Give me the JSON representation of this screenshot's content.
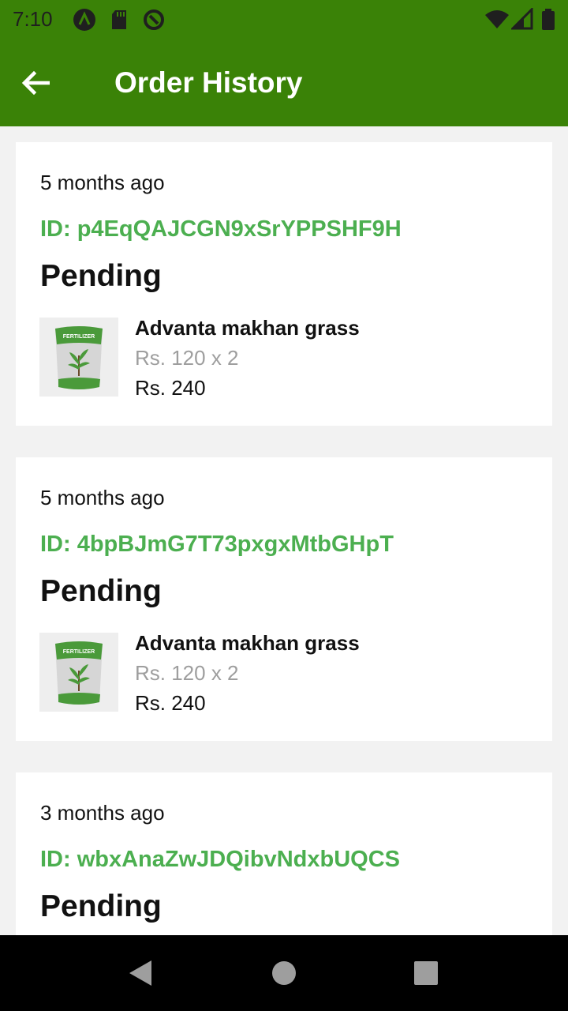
{
  "status_bar": {
    "time": "7:10",
    "icons": [
      "a-badge-icon",
      "sd-card-icon",
      "sync-icon",
      "wifi-icon",
      "signal-icon",
      "battery-icon"
    ]
  },
  "app_bar": {
    "title": "Order History",
    "back_icon": "arrow-left-icon",
    "color": "#3a8207"
  },
  "orders": [
    {
      "time": "5 months ago",
      "id": "ID: p4EqQAJCGN9xSrYPPSHF9H",
      "status": "Pending",
      "item": {
        "name": "Advanta makhan grass",
        "unit_price": "Rs. 120 x 2",
        "total": "Rs. 240",
        "image": "fertilizer-bag-icon"
      }
    },
    {
      "time": "5 months ago",
      "id": "ID: 4bpBJmG7T73pxgxMtbGHpT",
      "status": "Pending",
      "item": {
        "name": "Advanta makhan grass",
        "unit_price": "Rs. 120 x 2",
        "total": "Rs. 240",
        "image": "fertilizer-bag-icon"
      }
    },
    {
      "time": "3 months ago",
      "id": "ID: wbxAnaZwJDQibvNdxbUQCS",
      "status": "Pending"
    }
  ],
  "fertilizer_label": "FERTILIZER",
  "nav_bar": {
    "buttons": [
      "back-triangle-icon",
      "home-circle-icon",
      "recents-square-icon"
    ]
  },
  "colors": {
    "accent": "#3a8207",
    "id_green": "#4caf50",
    "muted": "#9e9e9e",
    "background": "#f2f2f2"
  }
}
